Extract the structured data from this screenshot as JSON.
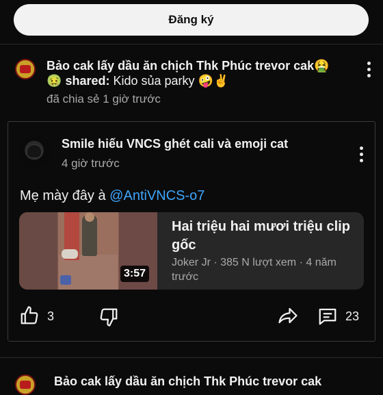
{
  "signup_button": "Đăng ký",
  "shared_post": {
    "line1": "Bảo cak lấy dầu ăn chịch Thk Phúc trevor cak🤮",
    "line2_emoji": "🤢",
    "line2_bold": "shared:",
    "line2_text": "Kido sủa parky 🤪✌️",
    "time": "đã chia sẻ 1 giờ trước"
  },
  "card": {
    "author": "Smile hiếu VNCS ghét cali và emoji cat",
    "time": "4 giờ trước",
    "text_prefix": "Mẹ mày đây à",
    "mention": "@AntiVNCS-o7",
    "video": {
      "title": "Hai triệu hai mươi triệu clip gốc",
      "meta": "Joker Jr · 385 N lượt xem · 4 năm trước",
      "duration": "3:57"
    },
    "likes": "3",
    "comments": "23"
  },
  "next_post": {
    "line1": "Bảo cak lấy dầu ăn chịch Thk Phúc trevor cak"
  },
  "icons": {
    "like": "thumbs-up-icon",
    "dislike": "thumbs-down-icon",
    "share": "share-arrow-icon",
    "comment": "comment-icon",
    "menu": "more-vertical-icon"
  }
}
